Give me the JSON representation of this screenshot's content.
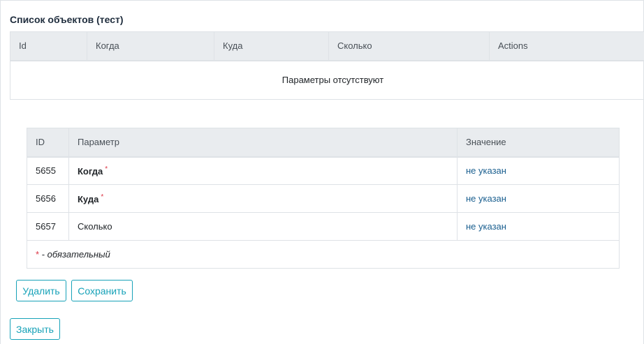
{
  "page": {
    "title": "Список объектов (тест)"
  },
  "objects_table": {
    "columns": [
      "Id",
      "Когда",
      "Куда",
      "Сколько",
      "Actions"
    ],
    "empty_text": "Параметры отсутствуют"
  },
  "params_table": {
    "columns": [
      "ID",
      "Параметр",
      "Значение"
    ],
    "rows": [
      {
        "id": "5655",
        "param": "Когда",
        "required_mark": "*",
        "value": "не указан"
      },
      {
        "id": "5656",
        "param": "Куда",
        "required_mark": "*",
        "value": "не указан"
      },
      {
        "id": "5657",
        "param": "Сколько",
        "required_mark": "",
        "value": "не указан"
      }
    ],
    "footnote_star": "*",
    "footnote_text": " - обязательный"
  },
  "buttons": {
    "delete": "Удалить",
    "save": "Сохранить",
    "close": "Закрыть"
  },
  "colors": {
    "accent": "#17a2b8",
    "link": "#1a5f8f",
    "required": "#dc3545",
    "header_bg": "#e9ecef"
  }
}
